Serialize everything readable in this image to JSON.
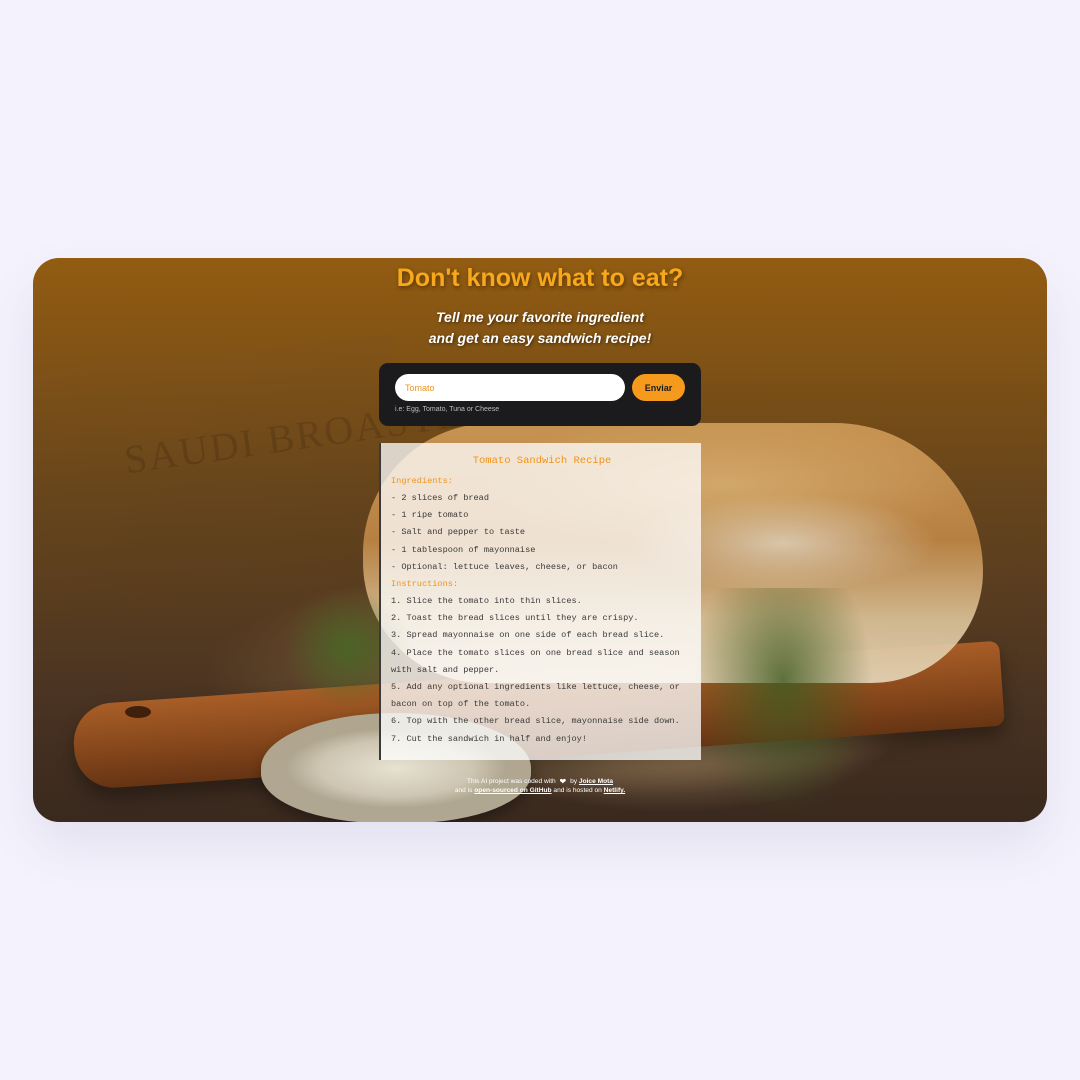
{
  "header": {
    "title": "Don't know what to eat?",
    "subtitle_line1": "Tell me your favorite ingredient",
    "subtitle_line2": "and get an easy sandwich recipe!"
  },
  "form": {
    "input_value": "Tomato",
    "input_placeholder": "Tomato",
    "submit_label": "Enviar",
    "hint": "i.e: Egg, Tomato, Tuna or Cheese"
  },
  "recipe": {
    "title": "Tomato Sandwich Recipe",
    "ingredients_label": "Ingredients:",
    "ingredients": [
      "- 2 slices of bread",
      "- 1 ripe tomato",
      "- Salt and pepper to taste",
      "- 1 tablespoon of mayonnaise",
      "- Optional: lettuce leaves, cheese, or bacon"
    ],
    "instructions_label": "Instructions:",
    "instructions": [
      "1. Slice the tomato into thin slices.",
      "2. Toast the bread slices until they are crispy.",
      "3. Spread mayonnaise on one side of each bread slice.",
      "4. Place the tomato slices on one bread slice and season with salt and pepper.",
      "5. Add any optional ingredients like lettuce, cheese, or bacon on top of the tomato.",
      "6. Top with the other bread slice, mayonnaise side down.",
      "7. Cut the sandwich in half and enjoy!"
    ]
  },
  "footer": {
    "text1": "This AI project was coded with",
    "heart_icon": "heart-icon",
    "by": "by",
    "author_link": "Joice Mota",
    "text2": "and is",
    "github_link": "open-sourced on GitHub",
    "text3": "and is hosted on",
    "netlify_link": "Netlify."
  },
  "background": {
    "crate_text": "SAUDI BROASTE"
  },
  "colors": {
    "accent": "#f59a1d",
    "title": "#f7a81b",
    "form_bg": "#1b1b1d",
    "page_bg": "#f4f2fc"
  }
}
